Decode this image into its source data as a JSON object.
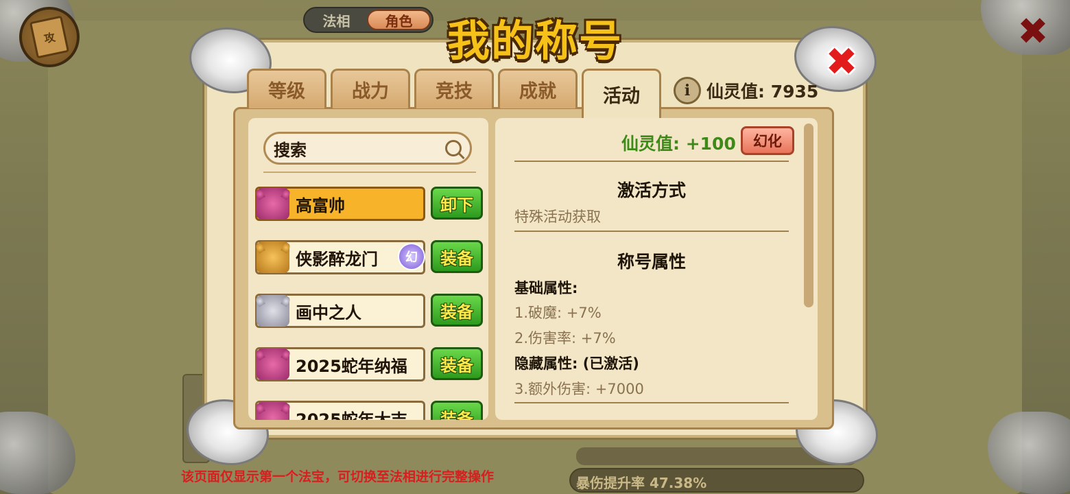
{
  "background": {
    "mode_switch": {
      "options": [
        "法相",
        "角色"
      ],
      "active": "角色"
    },
    "book_label": "攻",
    "bottom_note": "该页面仅显示第一个法宝，可切换至法相进行完整操作",
    "bottom_bar_text": "暴伤提升率 47.38%"
  },
  "dialog": {
    "title": "我的称号",
    "tabs": [
      {
        "label": "等级",
        "active": false
      },
      {
        "label": "战力",
        "active": false
      },
      {
        "label": "竞技",
        "active": false
      },
      {
        "label": "成就",
        "active": false
      },
      {
        "label": "活动",
        "active": true
      }
    ],
    "spirit_value_label": "仙灵值: 7935",
    "search": {
      "placeholder": "搜索"
    },
    "titles": [
      {
        "name": "高富帅",
        "action": "卸下",
        "selected": true,
        "avatar": "pink",
        "badge": ""
      },
      {
        "name": "侠影醉龙门",
        "action": "装备",
        "selected": false,
        "avatar": "gold",
        "badge": "幻"
      },
      {
        "name": "画中之人",
        "action": "装备",
        "selected": false,
        "avatar": "silver",
        "badge": ""
      },
      {
        "name": "2025蛇年纳福",
        "action": "装备",
        "selected": false,
        "avatar": "pink",
        "badge": ""
      },
      {
        "name": "2025蛇年大吉",
        "action": "装备",
        "selected": false,
        "avatar": "pink",
        "badge": ""
      }
    ],
    "detail": {
      "spirit_bonus": "仙灵值: +100",
      "huanhua_button": "幻化",
      "activation_title": "激活方式",
      "activation_method": "特殊活动获取",
      "attributes_title": "称号属性",
      "base_label": "基础属性:",
      "attr_1": "1.破魔: +7%",
      "attr_2": "2.伤害率: +7%",
      "hidden_label": "隐藏属性: (已激活)",
      "attr_3": "3.额外伤害: +7000"
    }
  },
  "colors": {
    "title_gold": "#f6c21a",
    "equip_green": "#2e9a1e",
    "selected_gold": "#f7b42a",
    "close_red": "#e21c1c",
    "note_red": "#d81e1e"
  }
}
